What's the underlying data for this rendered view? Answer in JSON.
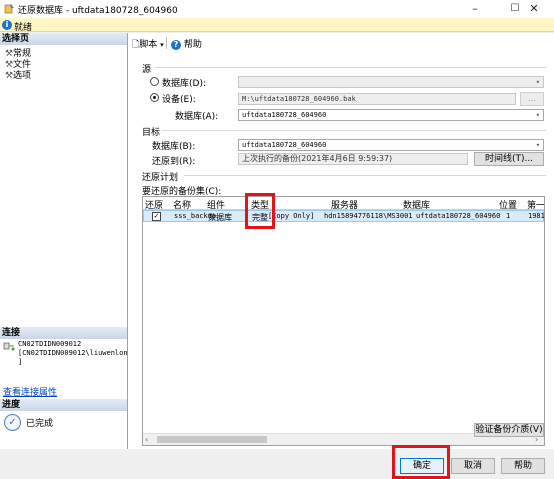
{
  "window": {
    "title": "还原数据库 - uftdata180728_604960",
    "minimize": "–",
    "maximize": "☐",
    "close": "✕"
  },
  "status": {
    "icon": "info-icon",
    "text": "就绪"
  },
  "left": {
    "select_page_header": "选择页",
    "pages": [
      "常规",
      "文件",
      "选项"
    ],
    "connection_header": "连接",
    "connection_lines": [
      "CN02TDIDN009012",
      "[CN02TDIDN009012\\liuwenlong",
      "]"
    ],
    "view_connection_props": "查看连接属性",
    "progress_header": "进度",
    "progress_status": "已完成"
  },
  "toolbar": {
    "script": "脚本",
    "help": "帮助"
  },
  "source": {
    "label": "源",
    "database_radio": "数据库(D):",
    "device_radio": "设备(E):",
    "device_path": "M:\\uftdata180728_604960.bak",
    "browse": "...",
    "database_label": "数据库(A):",
    "database_value": "uftdata180728_604960"
  },
  "target": {
    "label": "目标",
    "database_label": "数据库(B):",
    "database_value": "uftdata180728_604960",
    "restore_to_label": "还原到(R):",
    "restore_to_value": "上次执行的备份(2021年4月6日 9:59:37)",
    "timeline": "时间线(T)..."
  },
  "plan": {
    "label": "还原计划",
    "sets_label": "要还原的备份集(C):",
    "columns": [
      "还原",
      "名称",
      "组件",
      "类型",
      "服务器",
      "数据库",
      "位置",
      "第一"
    ],
    "row": {
      "checked": "✓",
      "name": "sss_backup",
      "component": "数据库",
      "type": "完整",
      "copy_only": "[Copy Only]",
      "server": "hdn15894776118\\MS3001",
      "database": "uftdata180728_604960",
      "position": "1",
      "first": "1981"
    },
    "verify_media": "验证备份介质(V)"
  },
  "footer": {
    "ok": "确定",
    "cancel": "取消",
    "help": "帮助"
  },
  "colors": {
    "highlight": "#e0151b",
    "link": "#0645c8",
    "selected_row": "#dcebfc"
  }
}
